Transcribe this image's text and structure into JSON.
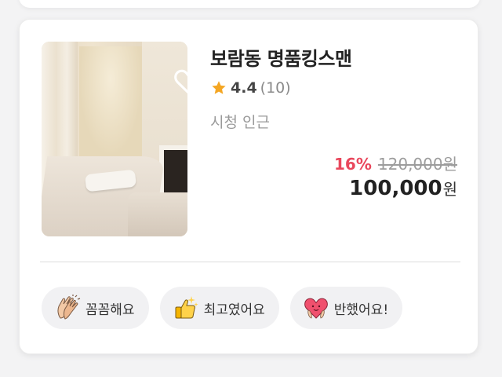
{
  "listing": {
    "name": "보람동 명품킹스맨",
    "rating": {
      "score": "4.4",
      "count": "(10)"
    },
    "location": "시청 인근",
    "price": {
      "discount": "16%",
      "original": "120,000원",
      "final_amount": "100,000",
      "currency": "원"
    },
    "favorite_icon": "heart-outline-icon"
  },
  "tags": [
    {
      "label": "꼼꼼해요",
      "icon": "clapping-hands-icon"
    },
    {
      "label": "최고였어요",
      "icon": "thumbs-up-sparkle-icon"
    },
    {
      "label": "반했어요!",
      "icon": "heart-face-icon"
    }
  ],
  "colors": {
    "discount": "#e9475c",
    "star": "#f4a623",
    "tag_background": "#f1f1f3"
  }
}
